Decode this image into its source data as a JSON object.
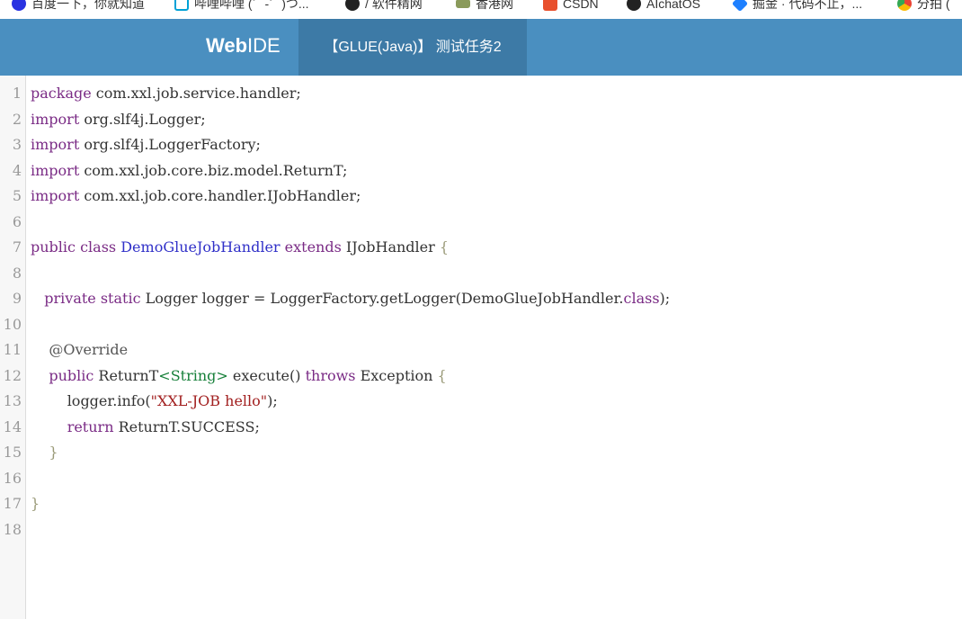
{
  "bookmarks": [
    {
      "label": "百度一下，你就知道",
      "icon": "baidu-icon",
      "color": "#2932e1"
    },
    {
      "label": "哔哩哔哩 (゜-゜)つ...",
      "icon": "bilibili-icon",
      "color": "#00a1d6"
    },
    {
      "label": "/ 软件精网",
      "icon": "github-icon",
      "color": "#222222"
    },
    {
      "label": "香港网",
      "icon": "folder-icon",
      "color": "#8a9a5b"
    },
    {
      "label": "CSDN",
      "icon": "csdn-icon",
      "color": "#e8502d"
    },
    {
      "label": "AIchatOS",
      "icon": "aichatos-icon",
      "color": "#222222"
    },
    {
      "label": "掘金 · 代码不止，...",
      "icon": "juejin-icon",
      "color": "#1e80ff"
    },
    {
      "label": "分拍 (",
      "icon": "chrome-icon",
      "color": "#ea4335"
    }
  ],
  "header": {
    "brand_bold": "Web",
    "brand_light": "IDE",
    "tab_title": "【GLUE(Java)】 测试任务2"
  },
  "editor": {
    "line_numbers": [
      "1",
      "2",
      "3",
      "4",
      "5",
      "6",
      "7",
      "8",
      "9",
      "10",
      "11",
      "12",
      "13",
      "14",
      "15",
      "16",
      "17",
      "18"
    ],
    "lines": [
      [
        {
          "t": "package",
          "c": "kw"
        },
        {
          "t": " com.xxl.job.service.handler;",
          "c": ""
        }
      ],
      [
        {
          "t": "import",
          "c": "kw"
        },
        {
          "t": " org.slf4j.Logger;",
          "c": ""
        }
      ],
      [
        {
          "t": "import",
          "c": "kw"
        },
        {
          "t": " org.slf4j.LoggerFactory;",
          "c": ""
        }
      ],
      [
        {
          "t": "import",
          "c": "kw"
        },
        {
          "t": " com.xxl.job.core.biz.model.ReturnT;",
          "c": ""
        }
      ],
      [
        {
          "t": "import",
          "c": "kw"
        },
        {
          "t": " com.xxl.job.core.handler.IJobHandler;",
          "c": ""
        }
      ],
      [],
      [
        {
          "t": "public",
          "c": "kw"
        },
        {
          "t": " ",
          "c": ""
        },
        {
          "t": "class",
          "c": "kw"
        },
        {
          "t": " ",
          "c": ""
        },
        {
          "t": "DemoGlueJobHandler",
          "c": "def"
        },
        {
          "t": " ",
          "c": ""
        },
        {
          "t": "extends",
          "c": "kw"
        },
        {
          "t": " IJobHandler ",
          "c": ""
        },
        {
          "t": "{",
          "c": "brk"
        }
      ],
      [],
      [
        {
          "t": "   ",
          "c": ""
        },
        {
          "t": "private",
          "c": "kw"
        },
        {
          "t": " ",
          "c": ""
        },
        {
          "t": "static",
          "c": "kw"
        },
        {
          "t": " Logger logger = LoggerFactory.getLogger(DemoGlueJobHandler.",
          "c": ""
        },
        {
          "t": "class",
          "c": "kw"
        },
        {
          "t": ");",
          "c": ""
        }
      ],
      [],
      [
        {
          "t": "    ",
          "c": ""
        },
        {
          "t": "@Override",
          "c": "anno"
        }
      ],
      [
        {
          "t": "    ",
          "c": ""
        },
        {
          "t": "public",
          "c": "kw"
        },
        {
          "t": " ReturnT",
          "c": ""
        },
        {
          "t": "<String>",
          "c": "type"
        },
        {
          "t": " execute() ",
          "c": ""
        },
        {
          "t": "throws",
          "c": "kw"
        },
        {
          "t": " Exception ",
          "c": ""
        },
        {
          "t": "{",
          "c": "brk"
        }
      ],
      [
        {
          "t": "        logger.info(",
          "c": ""
        },
        {
          "t": "\"XXL-JOB hello\"",
          "c": "str"
        },
        {
          "t": ");",
          "c": ""
        }
      ],
      [
        {
          "t": "        ",
          "c": ""
        },
        {
          "t": "return",
          "c": "kw"
        },
        {
          "t": " ReturnT.SUCCESS;",
          "c": ""
        }
      ],
      [
        {
          "t": "    ",
          "c": ""
        },
        {
          "t": "}",
          "c": "brk"
        }
      ],
      [],
      [
        {
          "t": "}",
          "c": "brk"
        }
      ],
      []
    ]
  }
}
